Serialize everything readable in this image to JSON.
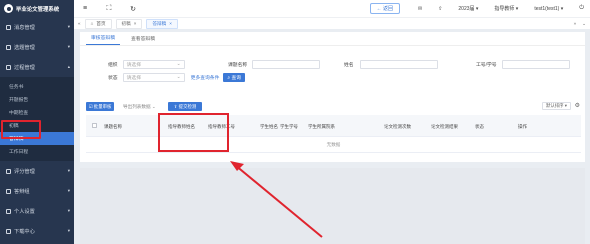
{
  "app": {
    "title": "毕业论文管理系统"
  },
  "colors": {
    "sidebar_bg": "#27364f",
    "accent": "#3b78d6",
    "annotation_red": "#e0242e"
  },
  "sidebar": {
    "items": [
      {
        "label": "消息管理",
        "icon": "message-icon"
      },
      {
        "label": "选题管理",
        "icon": "topic-icon"
      },
      {
        "label": "过程管理",
        "icon": "process-icon",
        "expanded": true
      }
    ],
    "sub_items": [
      {
        "label": "任务书"
      },
      {
        "label": "开题报告"
      },
      {
        "label": "中期检查"
      },
      {
        "label": "初稿"
      },
      {
        "label": "答辩稿",
        "active": true
      },
      {
        "label": "工作日程"
      }
    ],
    "items_after": [
      {
        "label": "评分管理",
        "icon": "score-icon"
      },
      {
        "label": "答辩组",
        "icon": "group-icon"
      },
      {
        "label": "个人设置",
        "icon": "user-icon"
      },
      {
        "label": "下载中心",
        "icon": "download-icon"
      }
    ]
  },
  "topbar": {
    "menu_icon": "menu-icon",
    "refresh_icon": "refresh-icon",
    "return_label": "← 返回",
    "year_label": "2023届 ▾",
    "role_label": "指导教师 ▾",
    "user_label": "test1(test1) ▾"
  },
  "tabs": {
    "items": [
      {
        "label": "首页"
      },
      {
        "label": "初稿"
      },
      {
        "label": "答辩稿",
        "active": true
      }
    ]
  },
  "subtabs": [
    {
      "label": "审核答辩稿",
      "active": true
    },
    {
      "label": "查看答辩稿"
    }
  ],
  "filters": {
    "group_label": "组织",
    "group_value": "请选择",
    "topic_label": "课题名称",
    "name_label": "姓名",
    "staff_label": "工号/学号",
    "status_label": "状态",
    "status_value": "请选择",
    "more_label": "更多查询条件",
    "query_label": "查询"
  },
  "toolbar": {
    "bulk_label": "批量审核",
    "export_label": "导出列表数据",
    "assign_label": "提交检测",
    "display_label": "默认排序 ▾"
  },
  "table": {
    "headers": [
      "课题名称",
      "指导教师姓名",
      "指导教师工号",
      "学生姓名",
      "学生学号",
      "学生所属院系",
      "论文检测次数",
      "论文检测结果",
      "状态",
      "操作"
    ],
    "empty_text": "无数据"
  }
}
